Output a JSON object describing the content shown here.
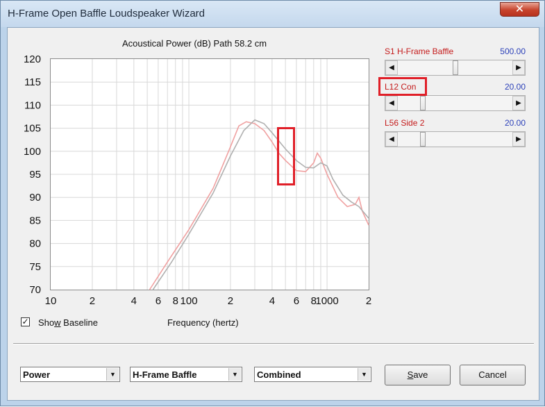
{
  "window": {
    "title": "H-Frame Open Baffle Loudspeaker Wizard",
    "close_glyph": "✕"
  },
  "chart_title": "Acoustical Power (dB)   Path 58.2 cm",
  "x_axis_title": "Frequency (hertz)",
  "show_baseline": {
    "label_pre": "Sho",
    "label_key": "w",
    "label_post": " Baseline",
    "checked": true,
    "check_glyph": "✓"
  },
  "params": [
    {
      "label": "S1  H-Frame Baffle",
      "value": "500.00"
    },
    {
      "label": "L12  Con",
      "value": "20.00"
    },
    {
      "label": "L56  Side 2",
      "value": "20.00"
    }
  ],
  "scroll_glyphs": {
    "left": "◀",
    "right": "▶"
  },
  "dropdowns": [
    {
      "value": "Power"
    },
    {
      "value": "H-Frame Baffle"
    },
    {
      "value": "Combined"
    }
  ],
  "dropdown_glyph": "▼",
  "buttons": {
    "save": "Save",
    "save_key": "S",
    "save_rest": "ave",
    "cancel": "Cancel"
  },
  "colors": {
    "current_curve": "#f0a0a0",
    "baseline_curve": "#b0b0b0",
    "highlight": "#e01f28"
  },
  "chart_data": {
    "type": "line",
    "x_scale": "log",
    "xlim": [
      10,
      2000
    ],
    "ylim": [
      70,
      120
    ],
    "y_ticks": [
      70,
      75,
      80,
      85,
      90,
      95,
      100,
      105,
      110,
      115,
      120
    ],
    "x_tick_labels": [
      {
        "x": 10,
        "label": "10"
      },
      {
        "x": 20,
        "label": "2"
      },
      {
        "x": 40,
        "label": "4"
      },
      {
        "x": 60,
        "label": "6"
      },
      {
        "x": 80,
        "label": "8"
      },
      {
        "x": 100,
        "label": "100"
      },
      {
        "x": 200,
        "label": "2"
      },
      {
        "x": 400,
        "label": "4"
      },
      {
        "x": 600,
        "label": "6"
      },
      {
        "x": 800,
        "label": "8"
      },
      {
        "x": 1000,
        "label": "1000"
      },
      {
        "x": 2000,
        "label": "2"
      }
    ],
    "series": [
      {
        "color": "#f0a0a0",
        "points": [
          [
            52,
            70
          ],
          [
            70,
            76
          ],
          [
            100,
            83
          ],
          [
            150,
            92
          ],
          [
            200,
            101
          ],
          [
            230,
            105.5
          ],
          [
            260,
            106.4
          ],
          [
            300,
            106
          ],
          [
            350,
            104.5
          ],
          [
            400,
            102
          ],
          [
            450,
            99.5
          ],
          [
            500,
            98
          ],
          [
            600,
            95.8
          ],
          [
            700,
            95.6
          ],
          [
            800,
            97.5
          ],
          [
            850,
            99.6
          ],
          [
            900,
            98.5
          ],
          [
            1000,
            95
          ],
          [
            1200,
            90
          ],
          [
            1400,
            88
          ],
          [
            1600,
            88.5
          ],
          [
            1700,
            90
          ],
          [
            1800,
            87
          ],
          [
            2000,
            84
          ]
        ]
      },
      {
        "color": "#b0b0b0",
        "points": [
          [
            55,
            70
          ],
          [
            75,
            76
          ],
          [
            100,
            82
          ],
          [
            150,
            91
          ],
          [
            200,
            99
          ],
          [
            250,
            104.5
          ],
          [
            300,
            106.8
          ],
          [
            350,
            106
          ],
          [
            400,
            104
          ],
          [
            500,
            100.5
          ],
          [
            600,
            98
          ],
          [
            700,
            96.5
          ],
          [
            800,
            96.4
          ],
          [
            900,
            97.5
          ],
          [
            1000,
            96.8
          ],
          [
            1100,
            94
          ],
          [
            1300,
            90.5
          ],
          [
            1500,
            89
          ],
          [
            1700,
            88
          ],
          [
            2000,
            85.5
          ]
        ]
      }
    ]
  }
}
